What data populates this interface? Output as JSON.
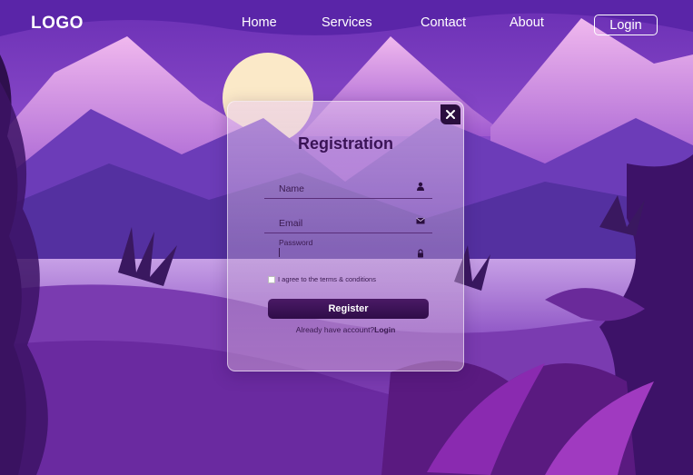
{
  "nav": {
    "logo": "LOGO",
    "links": [
      "Home",
      "Services",
      "Contact",
      "About"
    ],
    "login_label": "Login"
  },
  "form": {
    "title": "Registration",
    "name_label": "Name",
    "email_label": "Email",
    "password_label": "Password",
    "terms_text": "I agree to the terms & conditions",
    "register_label": "Register",
    "already_text": "Already have account?",
    "login_link": "Login",
    "close_icon": "close-icon"
  },
  "colors": {
    "accent": "#2f0c48",
    "title": "#3a1356",
    "sky": "#7b3fb6"
  },
  "icons": [
    "user-icon",
    "envelope-icon",
    "lock-icon",
    "close-icon"
  ]
}
